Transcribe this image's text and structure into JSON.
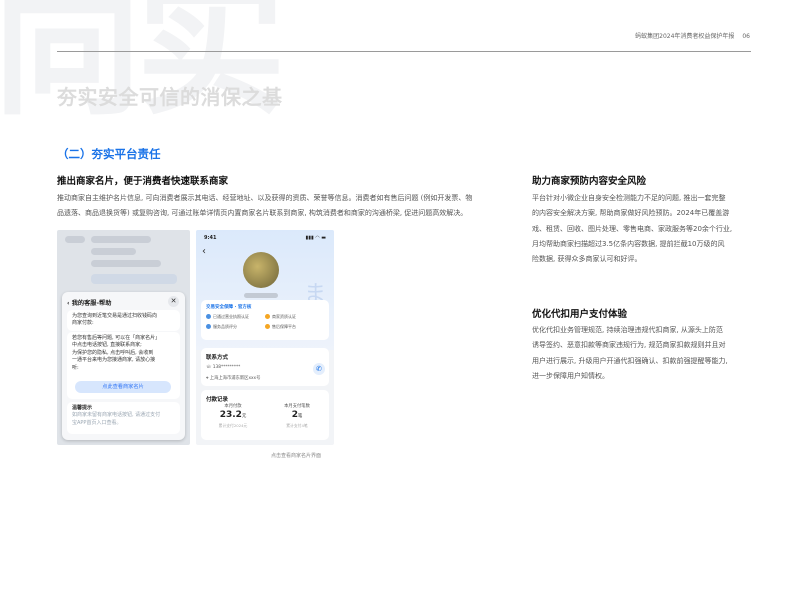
{
  "watermark": "向实",
  "header": {
    "report_title": "蚂蚁集团2024年消费者权益保护年报",
    "page_number": "06"
  },
  "page_title": "夯实安全可信的消保之基",
  "section_title": "（二）夯实平台责任",
  "left": {
    "heading": "推出商家名片，便于消费者快速联系商家",
    "paragraph_lines": [
      "推动商家自主维护名片信息, 可向消费者展示其电话、经营地址、以及获得的资质、荣誉等信息。消费者如有售后问题 (例如开发票、物",
      "品遗落、商品退换货等) 或复购咨询, 可通过账单详情页内置商家名片联系到商家, 构筑消费者和商家的沟通桥梁, 促进问题高效解决。"
    ],
    "caption": "点击查看商家名片界面"
  },
  "right_top": {
    "heading": "助力商家预防内容安全风险",
    "paragraph_lines": [
      "平台针对小微企业自身安全检测能力不足的问题, 推出一套完整",
      "的内容安全解决方案, 帮助商家做好风险预防。2024年已覆盖游",
      "戏、租赁、回收、图片处理、零售电商、家政服务等20余个行业,",
      "月均帮助商家扫描超过3.5亿条内容数据, 提前拦截10万级的风",
      "险数据, 获得众多商家认可和好评。"
    ]
  },
  "right_bottom": {
    "heading": "优化代扣用户支付体验",
    "paragraph_lines": [
      "优化代扣业务管理规范, 持续治理违规代扣商家, 从源头上防范",
      "诱导签约、恶意扣款等商家违规行为, 规范商家扣款规则并且对",
      "用户进行展示, 升级用户开通代扣强确认、扣款前强提醒等能力,",
      "进一步保障用户知情权。"
    ]
  },
  "screenshot_left": {
    "popup_title": "‹ 我的客服-帮助",
    "close_glyph": "✕",
    "bubble1_lines": [
      "为您查询到近笔交易是通过扫收钱码向",
      "商家付款:"
    ],
    "bubble2_lines": [
      "若您有售后等问题, 可以在「商家名片」",
      "中点击电话按钮, 直接联系商家;",
      "为保护您的隐私, 点击呼叫后, 会收到",
      "一通平台来电为您接通商家, 请放心接",
      "听:"
    ],
    "button_label": "点此查看商家名片",
    "tip_title": "温馨提示",
    "tip_lines": [
      "如商家未留有商家电话按钮, 请通过支付",
      "宝APP首页入口查看。"
    ]
  },
  "screenshot_right": {
    "status_time": "9:41",
    "status_icons": "▮▮▮ ◠ ▬",
    "back_glyph": "‹",
    "deco_glyph": "ま",
    "trust_heading": "交易安全保障 · 官方核",
    "trust_items": [
      "已通过营业执照认证",
      "商家资质认证",
      "服务品质评分",
      "售后保障平台"
    ],
    "contact_title": "联系方式",
    "contact_phone": "☏ 138*********",
    "contact_address": "⌖ 上海上海市浦东新区xxx号",
    "phone_glyph": "✆",
    "pay_title": "付款记录",
    "pay_cols": [
      {
        "label": "本月付款",
        "value": "23.2",
        "unit": "元",
        "sub": "累计支付2024元"
      },
      {
        "label": "本月支付笔数",
        "value": "2",
        "unit": "笔",
        "sub": "累计支付4笔"
      }
    ]
  }
}
